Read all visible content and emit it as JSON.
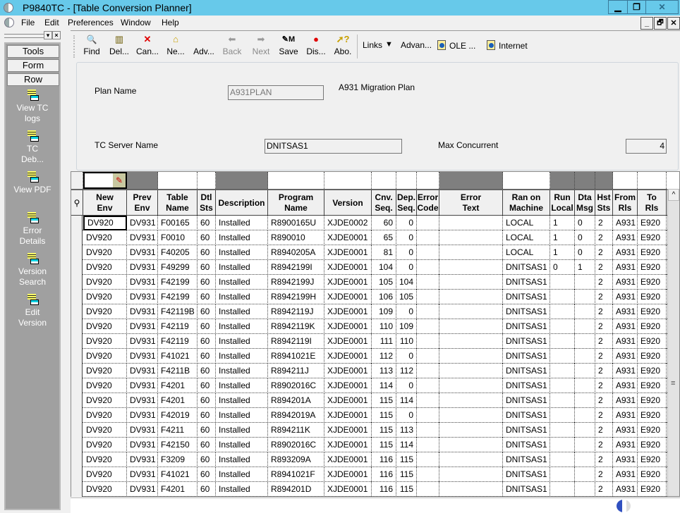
{
  "window": {
    "title": "P9840TC - [Table Conversion Planner]",
    "controls": {
      "minimize": "▁",
      "restore": "❐",
      "close": "✕"
    },
    "mdi_controls": {
      "minimize": "_",
      "restore": "🗗",
      "close": "✕"
    }
  },
  "menu": [
    "File",
    "Edit",
    "Preferences",
    "Window",
    "Help"
  ],
  "sidebar": {
    "tabs": [
      "Tools",
      "Form",
      "Row"
    ],
    "exits": [
      {
        "label_lines": [
          "View TC",
          "logs"
        ],
        "icon": "row-exit-icon"
      },
      {
        "label_lines": [
          "TC",
          "Deb..."
        ],
        "icon": "row-exit-icon"
      },
      {
        "label_lines": [
          "View PDF"
        ],
        "icon": "row-exit-icon"
      },
      {
        "label_lines": [
          "Error",
          "Details"
        ],
        "icon": "row-exit-icon"
      },
      {
        "label_lines": [
          "Version",
          "Search"
        ],
        "icon": "row-exit-icon"
      },
      {
        "label_lines": [
          "Edit",
          "Version"
        ],
        "icon": "row-exit-icon"
      }
    ]
  },
  "toolbar": {
    "buttons": [
      {
        "label": "Find",
        "icon": "find-icon",
        "glyph": "🔍",
        "enabled": true
      },
      {
        "label": "Del...",
        "icon": "delete-icon",
        "glyph": "🗑",
        "enabled": true
      },
      {
        "label": "Can...",
        "icon": "cancel-icon",
        "glyph": "✖",
        "enabled": true
      },
      {
        "label": "Ne...",
        "icon": "new-icon",
        "glyph": "📂",
        "enabled": true
      },
      {
        "label": "Adv...",
        "icon": "",
        "glyph": "",
        "enabled": true
      },
      {
        "label": "Back",
        "icon": "back-arrow-icon",
        "glyph": "⇦",
        "enabled": false
      },
      {
        "label": "Next",
        "icon": "next-arrow-icon",
        "glyph": "⇨",
        "enabled": false
      },
      {
        "label": "Save",
        "icon": "save-icon",
        "glyph": "✎",
        "enabled": true
      },
      {
        "label": "Dis...",
        "icon": "display-icon",
        "glyph": "●",
        "enabled": true
      },
      {
        "label": "Abo.",
        "icon": "about-icon",
        "glyph": "?",
        "enabled": true
      }
    ],
    "links": {
      "label": "Links",
      "dropdown": "▼"
    },
    "right_items": [
      "Advan...",
      "OLE ...",
      "Internet"
    ]
  },
  "header": {
    "plan_name_label": "Plan Name",
    "plan_name_value": "A931PLAN",
    "plan_description": "A931 Migration Plan",
    "tc_server_label": "TC Server Name",
    "tc_server_value": "DNITSAS1",
    "max_concurrent_label": "Max Concurrent",
    "max_concurrent_value": "4"
  },
  "grid": {
    "columns": [
      {
        "key": "new_env",
        "label": [
          "New",
          "Env"
        ],
        "qbe_dark": false
      },
      {
        "key": "prev_env",
        "label": [
          "Prev",
          "Env"
        ],
        "qbe_dark": true
      },
      {
        "key": "table_name",
        "label": [
          "Table",
          "Name"
        ],
        "qbe_dark": false
      },
      {
        "key": "dtl_sts",
        "label": [
          "Dtl",
          "Sts"
        ],
        "qbe_dark": false
      },
      {
        "key": "description",
        "label": [
          "Description"
        ],
        "qbe_dark": true
      },
      {
        "key": "program_name",
        "label": [
          "Program",
          "Name"
        ],
        "qbe_dark": false
      },
      {
        "key": "version",
        "label": [
          "Version"
        ],
        "qbe_dark": false
      },
      {
        "key": "cnv_seq",
        "label": [
          "Cnv.",
          "Seq."
        ],
        "qbe_dark": false
      },
      {
        "key": "dep_seq",
        "label": [
          "Dep.",
          "Seq."
        ],
        "qbe_dark": false
      },
      {
        "key": "error_code",
        "label": [
          "Error",
          "Code"
        ],
        "qbe_dark": false
      },
      {
        "key": "error_text",
        "label": [
          "Error",
          "Text"
        ],
        "qbe_dark": true
      },
      {
        "key": "ran_on_machine",
        "label": [
          "Ran on",
          "Machine"
        ],
        "qbe_dark": false
      },
      {
        "key": "run_local",
        "label": [
          "Run",
          "Local"
        ],
        "qbe_dark": true
      },
      {
        "key": "dta_msg",
        "label": [
          "Dta",
          "Msg"
        ],
        "qbe_dark": true
      },
      {
        "key": "hst_sts",
        "label": [
          "Hst",
          "Sts"
        ],
        "qbe_dark": true
      },
      {
        "key": "from_rls",
        "label": [
          "From",
          "Rls"
        ],
        "qbe_dark": false
      },
      {
        "key": "to_rls",
        "label": [
          "To",
          "Rls"
        ],
        "qbe_dark": false
      }
    ],
    "rows": [
      [
        "DV920",
        "DV931",
        "F00165",
        "60",
        "Installed",
        "R8900165U",
        "XJDE0002",
        "60",
        "0",
        "",
        "",
        "LOCAL",
        "1",
        "0",
        "2",
        "A931",
        "E920"
      ],
      [
        "DV920",
        "DV931",
        "F0010",
        "60",
        "Installed",
        "R890010",
        "XJDE0001",
        "65",
        "0",
        "",
        "",
        "LOCAL",
        "1",
        "0",
        "2",
        "A931",
        "E920"
      ],
      [
        "DV920",
        "DV931",
        "F40205",
        "60",
        "Installed",
        "R8940205A",
        "XJDE0001",
        "81",
        "0",
        "",
        "",
        "LOCAL",
        "1",
        "0",
        "2",
        "A931",
        "E920"
      ],
      [
        "DV920",
        "DV931",
        "F49299",
        "60",
        "Installed",
        "R8942199I",
        "XJDE0001",
        "104",
        "0",
        "",
        "",
        "DNITSAS1",
        "0",
        "1",
        "2",
        "A931",
        "E920"
      ],
      [
        "DV920",
        "DV931",
        "F42199",
        "60",
        "Installed",
        "R8942199J",
        "XJDE0001",
        "105",
        "104",
        "",
        "",
        "DNITSAS1",
        "",
        "",
        "2",
        "A931",
        "E920"
      ],
      [
        "DV920",
        "DV931",
        "F42199",
        "60",
        "Installed",
        "R8942199H",
        "XJDE0001",
        "106",
        "105",
        "",
        "",
        "DNITSAS1",
        "",
        "",
        "2",
        "A931",
        "E920"
      ],
      [
        "DV920",
        "DV931",
        "F42119B",
        "60",
        "Installed",
        "R8942119J",
        "XJDE0001",
        "109",
        "0",
        "",
        "",
        "DNITSAS1",
        "",
        "",
        "2",
        "A931",
        "E920"
      ],
      [
        "DV920",
        "DV931",
        "F42119",
        "60",
        "Installed",
        "R8942119K",
        "XJDE0001",
        "110",
        "109",
        "",
        "",
        "DNITSAS1",
        "",
        "",
        "2",
        "A931",
        "E920"
      ],
      [
        "DV920",
        "DV931",
        "F42119",
        "60",
        "Installed",
        "R8942119I",
        "XJDE0001",
        "111",
        "110",
        "",
        "",
        "DNITSAS1",
        "",
        "",
        "2",
        "A931",
        "E920"
      ],
      [
        "DV920",
        "DV931",
        "F41021",
        "60",
        "Installed",
        "R8941021E",
        "XJDE0001",
        "112",
        "0",
        "",
        "",
        "DNITSAS1",
        "",
        "",
        "2",
        "A931",
        "E920"
      ],
      [
        "DV920",
        "DV931",
        "F4211B",
        "60",
        "Installed",
        "R894211J",
        "XJDE0001",
        "113",
        "112",
        "",
        "",
        "DNITSAS1",
        "",
        "",
        "2",
        "A931",
        "E920"
      ],
      [
        "DV920",
        "DV931",
        "F4201",
        "60",
        "Installed",
        "R8902016C",
        "XJDE0001",
        "114",
        "0",
        "",
        "",
        "DNITSAS1",
        "",
        "",
        "2",
        "A931",
        "E920"
      ],
      [
        "DV920",
        "DV931",
        "F4201",
        "60",
        "Installed",
        "R894201A",
        "XJDE0001",
        "115",
        "114",
        "",
        "",
        "DNITSAS1",
        "",
        "",
        "2",
        "A931",
        "E920"
      ],
      [
        "DV920",
        "DV931",
        "F42019",
        "60",
        "Installed",
        "R8942019A",
        "XJDE0001",
        "115",
        "0",
        "",
        "",
        "DNITSAS1",
        "",
        "",
        "2",
        "A931",
        "E920"
      ],
      [
        "DV920",
        "DV931",
        "F4211",
        "60",
        "Installed",
        "R894211K",
        "XJDE0001",
        "115",
        "113",
        "",
        "",
        "DNITSAS1",
        "",
        "",
        "2",
        "A931",
        "E920"
      ],
      [
        "DV920",
        "DV931",
        "F42150",
        "60",
        "Installed",
        "R8902016C",
        "XJDE0001",
        "115",
        "114",
        "",
        "",
        "DNITSAS1",
        "",
        "",
        "2",
        "A931",
        "E920"
      ],
      [
        "DV920",
        "DV931",
        "F3209",
        "60",
        "Installed",
        "R893209A",
        "XJDE0001",
        "116",
        "115",
        "",
        "",
        "DNITSAS1",
        "",
        "",
        "2",
        "A931",
        "E920"
      ],
      [
        "DV920",
        "DV931",
        "F41021",
        "60",
        "Installed",
        "R8941021F",
        "XJDE0001",
        "116",
        "115",
        "",
        "",
        "DNITSAS1",
        "",
        "",
        "2",
        "A931",
        "E920"
      ],
      [
        "DV920",
        "DV931",
        "F4201",
        "60",
        "Installed",
        "R894201D",
        "XJDE0001",
        "116",
        "115",
        "",
        "",
        "DNITSAS1",
        "",
        "",
        "2",
        "A931",
        "E920"
      ]
    ]
  },
  "scrollbar": {
    "up": "^",
    "thumb": "≡"
  }
}
